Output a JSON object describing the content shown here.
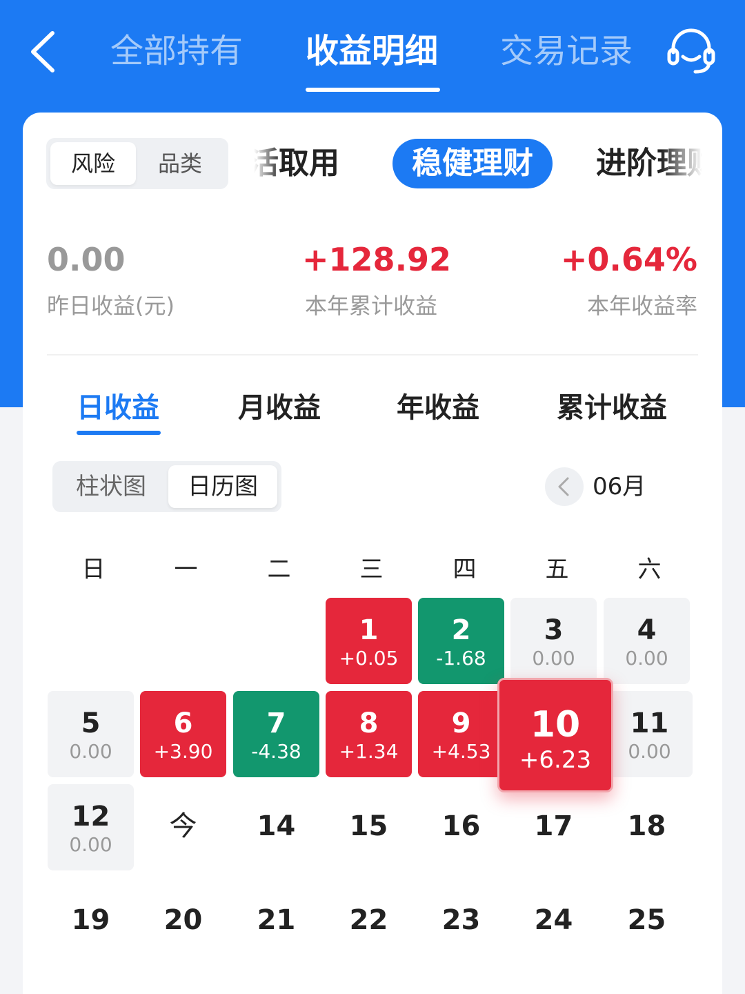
{
  "header": {
    "tabs": [
      {
        "label": "全部持有",
        "active": false
      },
      {
        "label": "收益明细",
        "active": true
      },
      {
        "label": "交易记录",
        "active": false
      }
    ]
  },
  "filter": {
    "segments": [
      {
        "label": "风险",
        "active": true
      },
      {
        "label": "品类",
        "active": false
      }
    ],
    "categories": [
      {
        "label": "活取用",
        "active": false
      },
      {
        "label": "稳健理财",
        "active": true
      },
      {
        "label": "进阶理财",
        "active": false
      }
    ]
  },
  "stats": {
    "yesterday": {
      "value": "0.00",
      "label": "昨日收益(元)"
    },
    "year_total": {
      "value": "+128.92",
      "label": "本年累计收益"
    },
    "year_rate": {
      "value": "+0.64%",
      "label": "本年收益率"
    }
  },
  "period_tabs": [
    {
      "label": "日收益",
      "active": true
    },
    {
      "label": "月收益",
      "active": false
    },
    {
      "label": "年收益",
      "active": false
    },
    {
      "label": "累计收益",
      "active": false
    }
  ],
  "view_toggle": [
    {
      "label": "柱状图",
      "active": false
    },
    {
      "label": "日历图",
      "active": true
    }
  ],
  "month": "06月",
  "weekdays": [
    "日",
    "一",
    "二",
    "三",
    "四",
    "五",
    "六"
  ],
  "calendar": {
    "days": [
      {
        "day": "1",
        "value": "+0.05",
        "state": "up"
      },
      {
        "day": "2",
        "value": "-1.68",
        "state": "down"
      },
      {
        "day": "3",
        "value": "0.00",
        "state": "zero"
      },
      {
        "day": "4",
        "value": "0.00",
        "state": "zero"
      },
      {
        "day": "5",
        "value": "0.00",
        "state": "zero"
      },
      {
        "day": "6",
        "value": "+3.90",
        "state": "up"
      },
      {
        "day": "7",
        "value": "-4.38",
        "state": "down"
      },
      {
        "day": "8",
        "value": "+1.34",
        "state": "up"
      },
      {
        "day": "9",
        "value": "+4.53",
        "state": "up"
      },
      {
        "day": "10",
        "value": "+6.23",
        "state": "up",
        "selected": true
      },
      {
        "day": "11",
        "value": "0.00",
        "state": "zero"
      },
      {
        "day": "12",
        "value": "0.00",
        "state": "zero"
      },
      {
        "day": "今",
        "value": "",
        "state": "plain"
      },
      {
        "day": "14",
        "value": "",
        "state": "plain"
      },
      {
        "day": "15",
        "value": "",
        "state": "plain"
      },
      {
        "day": "16",
        "value": "",
        "state": "plain"
      },
      {
        "day": "17",
        "value": "",
        "state": "plain"
      },
      {
        "day": "18",
        "value": "",
        "state": "plain"
      },
      {
        "day": "19",
        "value": "",
        "state": "plain"
      },
      {
        "day": "20",
        "value": "",
        "state": "plain"
      },
      {
        "day": "21",
        "value": "",
        "state": "plain"
      },
      {
        "day": "22",
        "value": "",
        "state": "plain"
      },
      {
        "day": "23",
        "value": "",
        "state": "plain"
      },
      {
        "day": "24",
        "value": "",
        "state": "plain"
      },
      {
        "day": "25",
        "value": "",
        "state": "plain"
      }
    ]
  },
  "colors": {
    "brand": "#1c7af3",
    "gain": "#e5273b",
    "loss": "#12976e"
  }
}
